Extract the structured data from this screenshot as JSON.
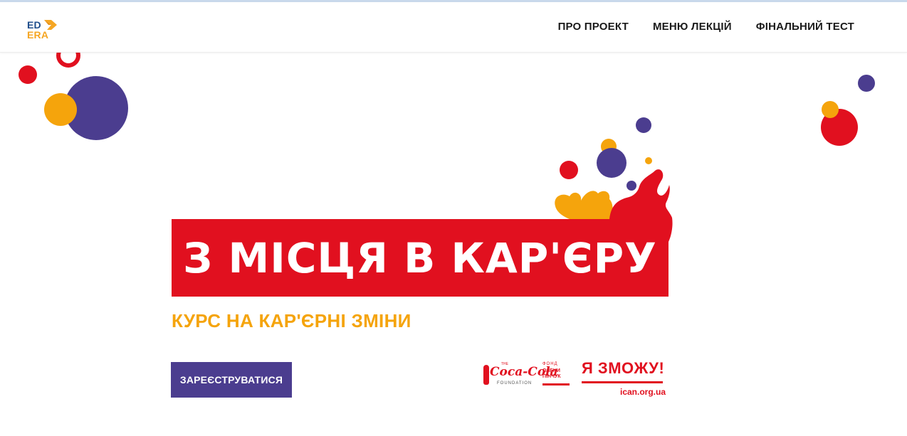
{
  "logo": {
    "line1": "ED",
    "line2": "ERA"
  },
  "nav": {
    "items": [
      {
        "label": "ПРО ПРОЕКТ"
      },
      {
        "label": "МЕНЮ ЛЕКЦІЙ"
      },
      {
        "label": "ФІНАЛЬНИЙ ТЕСТ"
      }
    ]
  },
  "hero": {
    "title": "З МІСЦЯ В КАР'ЄРУ",
    "subtitle": "КУРС НА КАР'ЄРНІ ЗМІНИ",
    "register_label": "ЗАРЕЄСТРУВАТИСЯ"
  },
  "partners": {
    "coca_cola": {
      "the": "THE",
      "name": "Coca-Cola",
      "foundation": "FOUNDATION"
    },
    "pinchuk": {
      "top": "ФОНД",
      "line1": "ОЛЕНИ",
      "line2": "ПІНЧУК"
    },
    "ican": {
      "slogan": "Я ЗМОЖУ!",
      "url": "ican.org.ua"
    }
  },
  "colors": {
    "red": "#e1101f",
    "purple": "#4b3d8f",
    "orange": "#f5a40c",
    "navy": "#1f4e8c"
  }
}
